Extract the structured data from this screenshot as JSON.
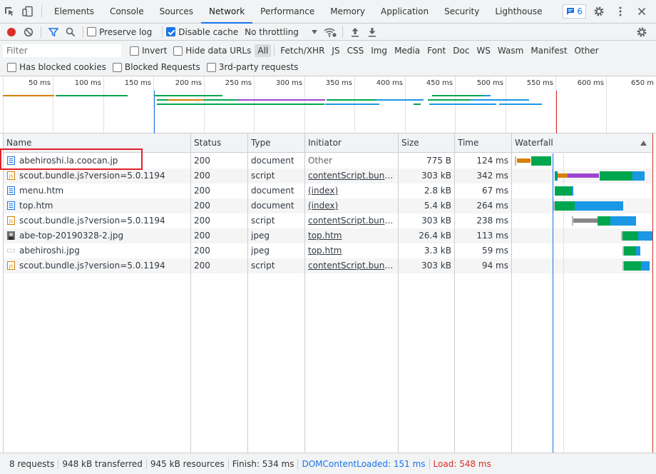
{
  "tabs": [
    {
      "label": "Elements"
    },
    {
      "label": "Console"
    },
    {
      "label": "Sources"
    },
    {
      "label": "Network",
      "active": true
    },
    {
      "label": "Performance"
    },
    {
      "label": "Memory"
    },
    {
      "label": "Application"
    },
    {
      "label": "Security"
    },
    {
      "label": "Lighthouse"
    }
  ],
  "issues_count": "6",
  "toolbar": {
    "preserve_log": "Preserve log",
    "disable_cache": "Disable cache",
    "throttling": "No throttling"
  },
  "filter": {
    "placeholder": "Filter",
    "invert": "Invert",
    "hide_data_urls": "Hide data URLs",
    "types": [
      "All",
      "Fetch/XHR",
      "JS",
      "CSS",
      "Img",
      "Media",
      "Font",
      "Doc",
      "WS",
      "Wasm",
      "Manifest",
      "Other"
    ],
    "blocked_cookies": "Has blocked cookies",
    "blocked_requests": "Blocked Requests",
    "third_party": "3rd-party requests"
  },
  "overview_ticks": [
    "50 ms",
    "100 ms",
    "150 ms",
    "200 ms",
    "250 ms",
    "300 ms",
    "350 ms",
    "400 ms",
    "450 ms",
    "500 ms",
    "550 ms",
    "600 ms",
    "650 m"
  ],
  "columns": {
    "name": "Name",
    "status": "Status",
    "type": "Type",
    "initiator": "Initiator",
    "size": "Size",
    "time": "Time",
    "waterfall": "Waterfall"
  },
  "requests": [
    {
      "name": "abehiroshi.la.coocan.jp",
      "icon": "document-icon",
      "status": "200",
      "type": "document",
      "initiator": "Other",
      "size": "775 B",
      "time": "124 ms"
    },
    {
      "name": "scout.bundle.js?version=5.0.1194",
      "icon": "script-icon",
      "status": "200",
      "type": "script",
      "initiator": "contentScript.bundle....",
      "size": "303 kB",
      "time": "342 ms"
    },
    {
      "name": "menu.htm",
      "icon": "document-icon",
      "status": "200",
      "type": "document",
      "initiator": "(index)",
      "size": "2.8 kB",
      "time": "67 ms"
    },
    {
      "name": "top.htm",
      "icon": "document-icon",
      "status": "200",
      "type": "document",
      "initiator": "(index)",
      "size": "5.4 kB",
      "time": "264 ms"
    },
    {
      "name": "scout.bundle.js?version=5.0.1194",
      "icon": "script-icon",
      "status": "200",
      "type": "script",
      "initiator": "contentScript.bundle....",
      "size": "303 kB",
      "time": "238 ms"
    },
    {
      "name": "abe-top-20190328-2.jpg",
      "icon": "image-thumbnail-icon",
      "status": "200",
      "type": "jpeg",
      "initiator": "top.htm",
      "size": "26.4 kB",
      "time": "113 ms"
    },
    {
      "name": "abehiroshi.jpg",
      "icon": "image-placeholder-icon",
      "status": "200",
      "type": "jpeg",
      "initiator": "top.htm",
      "size": "3.3 kB",
      "time": "59 ms"
    },
    {
      "name": "scout.bundle.js?version=5.0.1194",
      "icon": "script-icon",
      "status": "200",
      "type": "script",
      "initiator": "contentScript.bundle....",
      "size": "303 kB",
      "time": "94 ms"
    }
  ],
  "status": {
    "requests": "8 requests",
    "transferred": "948 kB transferred",
    "resources": "945 kB resources",
    "finish": "Finish: 534 ms",
    "dom_content_loaded": "DOMContentLoaded: 151 ms",
    "load": "Load: 548 ms"
  },
  "colors": {
    "accent": "#1a73e8",
    "record": "#d93025",
    "dcl": "#1a73e8",
    "load": "#d93025",
    "wait": "#00a64e",
    "download": "#1a98e6",
    "queue": "#d68100",
    "script": "#9f44d1"
  }
}
